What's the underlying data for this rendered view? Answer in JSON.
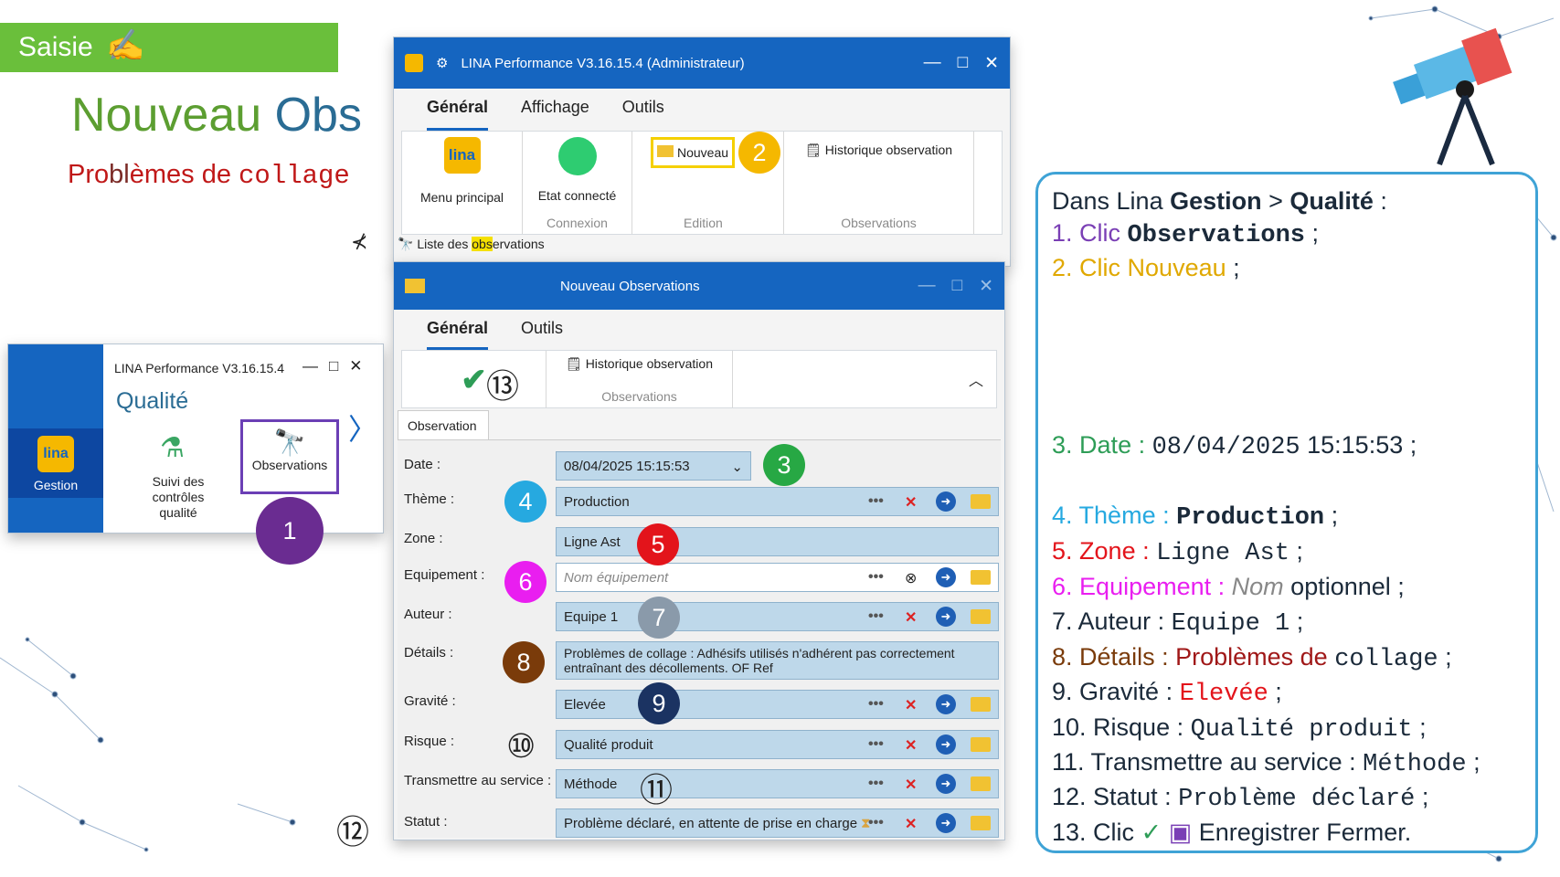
{
  "slide": {
    "tag": "Saisie",
    "title_a": "Nouveau",
    "title_b": "Obs",
    "subtitle_a": "Pro",
    "subtitle_b": "bl",
    "subtitle_c": "èmes de ",
    "subtitle_d": "collage"
  },
  "main_window": {
    "title": "LINA Performance  V3.16.15.4  (Administrateur)",
    "tabs": [
      "Général",
      "Affichage",
      "Outils"
    ],
    "ribbon": {
      "menu_principal": "Menu principal",
      "lina_logo": "lina",
      "etat": "Etat connecté",
      "connexion": "Connexion",
      "nouveau": "Nouveau",
      "edition": "Edition",
      "historique": "Historique observation",
      "observations": "Observations"
    },
    "list_pre": "Liste des ",
    "list_hl": "obs",
    "list_post": "ervations"
  },
  "small_window": {
    "title": "LINA Performance  V3.16.15.4",
    "section": "Qualité",
    "gestion": "Gestion",
    "suivi": "Suivi des contrôles qualité",
    "observations": "Observations"
  },
  "dialog": {
    "title": "Nouveau Observations",
    "tabs": [
      "Général",
      "Outils"
    ],
    "historique": "Historique observation",
    "historique_sub": "Observations",
    "obs_tab": "Observation",
    "labels": {
      "date": "Date :",
      "theme": "Thème :",
      "zone": "Zone :",
      "equipement": "Equipement :",
      "auteur": "Auteur :",
      "details": "Détails :",
      "gravite": "Gravité :",
      "risque": "Risque :",
      "transmettre": "Transmettre au service :",
      "statut": "Statut :"
    },
    "values": {
      "date": "08/04/2025 15:15:53",
      "theme": "Production",
      "zone": "Ligne Ast",
      "equipement_placeholder": "Nom équipement",
      "auteur": "Equipe 1",
      "details": "Problèmes de collage : Adhésifs utilisés n'adhérent pas correctement entraînant des décollements. OF                  Ref",
      "gravite": "Elevée",
      "risque": "Qualité produit",
      "transmettre": "Méthode",
      "statut": "Problème déclaré, en attente de prise en charge"
    }
  },
  "markers": {
    "n1": "1",
    "n2": "2",
    "n3": "3",
    "n4": "4",
    "n5": "5",
    "n6": "6",
    "n7": "7",
    "n8": "8",
    "n9": "9",
    "n10": "⑩",
    "n11": "⑪",
    "n12": "⑫",
    "n13": "⑬"
  },
  "panel": {
    "l0a": "Dans Lina ",
    "l0b": "Gestion",
    "l0c": " > ",
    "l0d": "Qualité",
    "l0e": " :",
    "l1n": "1.",
    "l1a": "Clic ",
    "l1b": "Observations",
    "l1c": " ;",
    "l2n": "2.",
    "l2a": "Clic ",
    "l2b": "Nouveau",
    "l2c": " ;",
    "l3n": "3.",
    "l3a": "Date : ",
    "l3b": "08/04/2025",
    "l3c": " 15:15:53 ;",
    "l4n": "4.",
    "l4a": "Thème : ",
    "l4b": "Production",
    "l4c": " ;",
    "l5n": "5.",
    "l5a": "Zone : ",
    "l5b": "Ligne Ast",
    "l5c": " ;",
    "l6n": "6.",
    "l6a": "Equipement : ",
    "l6b": "Nom",
    "l6c": " optionnel ;",
    "l7n": "7.",
    "l7a": "Auteur : ",
    "l7b": "Equipe 1",
    "l7c": " ;",
    "l8n": "8.",
    "l8a": "Détails : ",
    "l8b": "Problèmes de ",
    "l8c": "collage",
    "l8d": " ;",
    "l9n": "9.",
    "l9a": "Gravité : ",
    "l9b": "Elevée",
    "l9c": " ;",
    "l10": "10. Risque : ",
    "l10b": "Qualité produit",
    "l10c": " ;",
    "l11": "11. Transmettre au service : ",
    "l11b": "Méthode",
    "l11c": " ;",
    "l12": "12. Statut : ",
    "l12b": "Problème déclaré",
    "l12c": " ;",
    "l13": "13. Clic ",
    "l13b": "✓",
    "l13c": "Enregistrer Fermer."
  },
  "colors": {
    "accent": "#1565c0",
    "green": "#6abf3b",
    "panel_border": "#3fa3d6"
  }
}
